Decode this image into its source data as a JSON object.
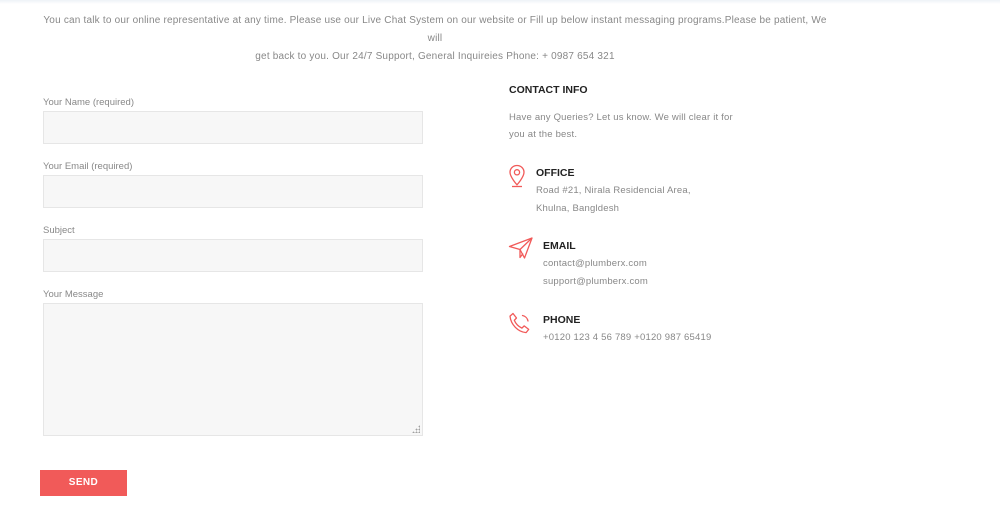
{
  "intro": {
    "line1": "You can talk to our online representative at any time. Please use our Live Chat System on our website or Fill up below instant messaging programs.Please be patient, We will",
    "line2": "get back to you. Our 24/7 Support, General Inquireies Phone: + 0987 654 321"
  },
  "form": {
    "name_label": "Your Name (required)",
    "name_value": "",
    "email_label": "Your Email (required)",
    "email_value": "",
    "subject_label": "Subject",
    "subject_value": "",
    "message_label": "Your Message",
    "message_value": "",
    "send_label": "SEND"
  },
  "contact_info": {
    "heading": "CONTACT INFO",
    "desc_line1": "Have any Queries? Let us know. We will clear it for",
    "desc_line2": "you at the best.",
    "office": {
      "icon": "map-pin-icon",
      "title": "OFFICE",
      "line1": "Road #21, Nirala Residencial Area,",
      "line2": "Khulna, Bangldesh"
    },
    "email": {
      "icon": "paper-plane-icon",
      "title": "EMAIL",
      "line1": "contact@plumberx.com",
      "line2": "support@plumberx.com"
    },
    "phone": {
      "icon": "phone-icon",
      "title": "PHONE",
      "line1": "+0120 123 4 56 789 +0120 987 65419"
    }
  },
  "colors": {
    "accent": "#f15a59",
    "field_bg": "#f7f7f7",
    "heading": "#222222",
    "text": "#888888"
  }
}
